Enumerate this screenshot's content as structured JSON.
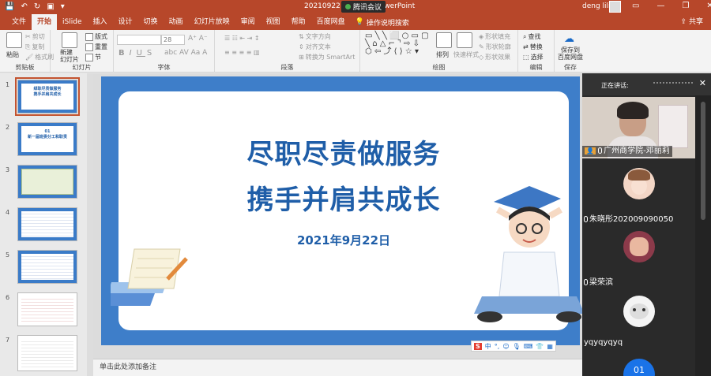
{
  "titlebar": {
    "doc_title_left": "20210922",
    "doc_title_right": "owerPoint",
    "meeting_label": "腾讯会议",
    "user_name": "deng lili"
  },
  "tabs": [
    {
      "label": "文件"
    },
    {
      "label": "开始",
      "active": true
    },
    {
      "label": "iSlide"
    },
    {
      "label": "插入"
    },
    {
      "label": "设计"
    },
    {
      "label": "切换"
    },
    {
      "label": "动画"
    },
    {
      "label": "幻灯片放映"
    },
    {
      "label": "审阅"
    },
    {
      "label": "视图"
    },
    {
      "label": "帮助"
    },
    {
      "label": "百度网盘"
    }
  ],
  "tab_search": "操作说明搜索",
  "share_label": "共享",
  "ribbon": {
    "paste": "粘贴",
    "cut": "剪切",
    "copy": "复制",
    "format_painter": "格式刷",
    "clipboard_group": "剪贴板",
    "new_slide": "新建\n幻灯片",
    "layout": "版式",
    "reset": "重置",
    "section": "节",
    "slides_group": "幻灯片",
    "font_size": "28",
    "font_group": "字体",
    "text_direction": "文字方向",
    "align_text": "对齐文本",
    "smartart": "转换为 SmartArt",
    "paragraph_group": "段落",
    "arrange": "排列",
    "quick_styles": "快速样式",
    "shape_fill": "形状填充",
    "shape_outline": "形状轮廓",
    "shape_effects": "形状效果",
    "drawing_group": "绘图",
    "find": "查找",
    "replace": "替换",
    "select": "选择",
    "editing_group": "编辑",
    "save_baidu": "保存到\n百度网盘",
    "save_group": "保存"
  },
  "thumbnails": [
    {
      "num": "1",
      "text": "绿职尽责做服务\n携手并肩共成长"
    },
    {
      "num": "2",
      "text": "01\n新一届班委分工和职责"
    },
    {
      "num": "3",
      "text": ""
    },
    {
      "num": "4",
      "text": ""
    },
    {
      "num": "5",
      "text": ""
    },
    {
      "num": "6",
      "text": ""
    },
    {
      "num": "7",
      "text": ""
    }
  ],
  "slide": {
    "line1": "尽职尽责做服务",
    "line2": "携手并肩共成长",
    "date": "2021年9月22日"
  },
  "ime": {
    "logo": "S",
    "mode": "中"
  },
  "notes_placeholder": "单击此处添加备注",
  "meeting": {
    "speaking_label": "正在讲话:",
    "participants": [
      {
        "name": "广州商学院-邓丽莉"
      },
      {
        "name": "朱晓彤202009090050"
      },
      {
        "name": "梁荣滨"
      },
      {
        "name": "yqyqyqyq"
      }
    ],
    "badge": "01"
  }
}
